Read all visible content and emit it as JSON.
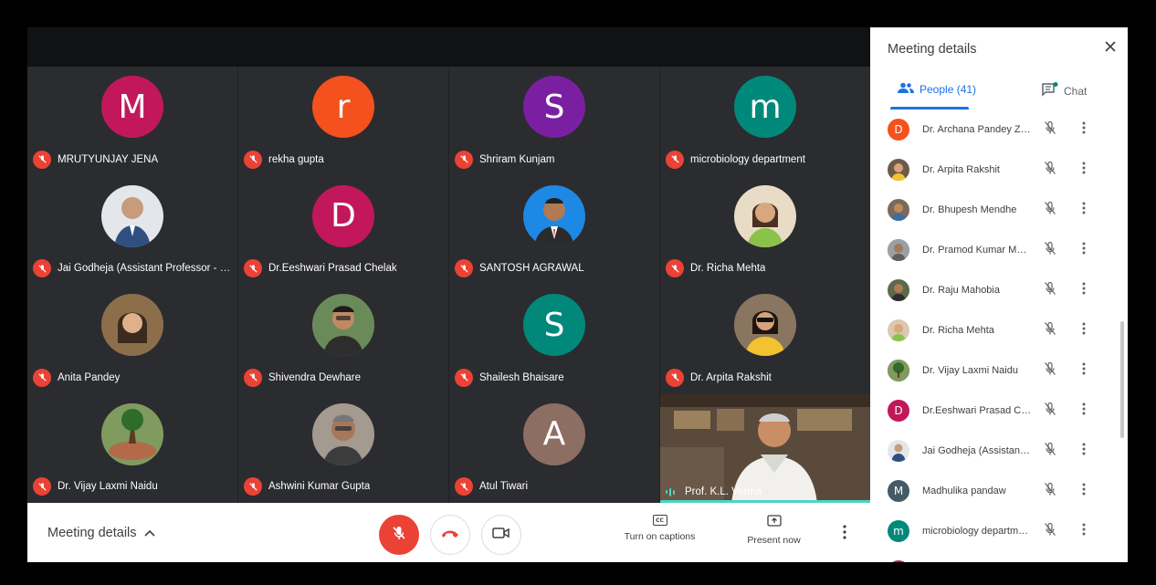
{
  "tiles": [
    {
      "name": "MRUTYUNJAY JENA",
      "initial": "M",
      "color": "#c2185b"
    },
    {
      "name": "rekha gupta",
      "initial": "r",
      "color": "#f4511e"
    },
    {
      "name": "Shriram Kunjam",
      "initial": "S",
      "color": "#7b1fa2"
    },
    {
      "name": "microbiology department",
      "initial": "m",
      "color": "#00897b"
    },
    {
      "name": "Jai Godheja (Assistant Professor - ML...",
      "initial": "",
      "color": "#d7dadf"
    },
    {
      "name": "Dr.Eeshwari Prasad Chelak",
      "initial": "D",
      "color": "#c2185b"
    },
    {
      "name": "SANTOSH AGRAWAL",
      "initial": "",
      "color": "#1e88e5"
    },
    {
      "name": "Dr. Richa Mehta",
      "initial": "",
      "color": "#d9c9b2"
    },
    {
      "name": "Anita Pandey",
      "initial": "",
      "color": "#8d6e4a"
    },
    {
      "name": "Shivendra Dewhare",
      "initial": "",
      "color": "#5d4a3a"
    },
    {
      "name": "Shailesh Bhaisare",
      "initial": "S",
      "color": "#00897b"
    },
    {
      "name": "Dr. Arpita Rakshit",
      "initial": "",
      "color": "#6d5a48"
    },
    {
      "name": "Dr. Vijay Laxmi Naidu",
      "initial": "",
      "color": "#4e6b3a"
    },
    {
      "name": "Ashwini Kumar Gupta",
      "initial": "",
      "color": "#6b5f55"
    },
    {
      "name": "Atul Tiwari",
      "initial": "A",
      "color": "#8d6e63"
    }
  ],
  "speaker": {
    "name": "Prof. K.L. Verma"
  },
  "bottom_bar": {
    "meeting_details": "Meeting details",
    "captions": "Turn on captions",
    "captions_icon": "CC",
    "present": "Present now"
  },
  "panel": {
    "title": "Meeting details",
    "people_tab": "People (41)",
    "chat_tab": "Chat",
    "people": [
      {
        "name": "Dr. Archana Pandey Zoo...",
        "initial": "D",
        "color": "#f4511e"
      },
      {
        "name": "Dr. Arpita Rakshit",
        "initial": "",
        "color": "#6d5a48"
      },
      {
        "name": "Dr. Bhupesh Mendhe",
        "initial": "",
        "color": "#7a6a5a"
      },
      {
        "name": "Dr. Pramod Kumar Mahi...",
        "initial": "",
        "color": "#8a7a6a"
      },
      {
        "name": "Dr. Raju Mahobia",
        "initial": "",
        "color": "#5a6a4a"
      },
      {
        "name": "Dr. Richa Mehta",
        "initial": "",
        "color": "#d9c9b2"
      },
      {
        "name": "Dr. Vijay Laxmi Naidu",
        "initial": "",
        "color": "#4e6b3a"
      },
      {
        "name": "Dr.Eeshwari Prasad Che...",
        "initial": "D",
        "color": "#c2185b"
      },
      {
        "name": "Jai Godheja (Assistant ...",
        "initial": "",
        "color": "#3f6fa6"
      },
      {
        "name": "Madhulika pandaw",
        "initial": "M",
        "color": "#455a64"
      },
      {
        "name": "microbiology departme...",
        "initial": "m",
        "color": "#00897b"
      },
      {
        "name": "",
        "initial": "",
        "color": "#c2185b"
      }
    ]
  },
  "colors": {
    "mic_off": "#ea4335",
    "accent": "#1a73e8",
    "speaking": "#4fd3c4"
  }
}
